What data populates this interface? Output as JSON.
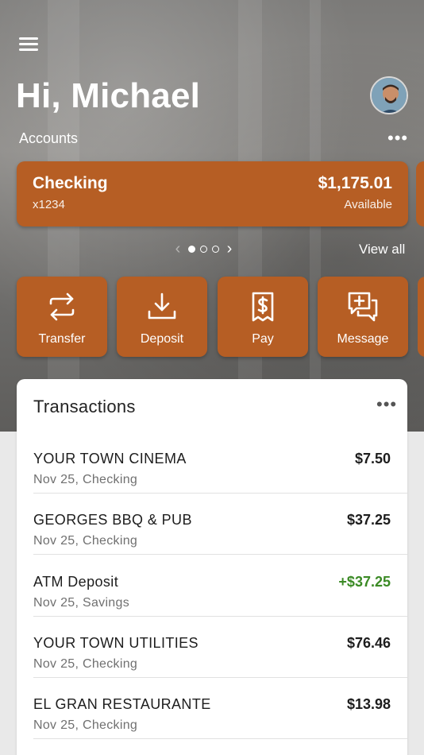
{
  "header": {
    "greeting": "Hi, Michael",
    "accounts_label": "Accounts",
    "menu_icon": "hamburger-menu-icon",
    "more_icon": "ellipsis-icon"
  },
  "account_card": {
    "name": "Checking",
    "number": "x1234",
    "balance": "$1,175.01",
    "balance_label": "Available"
  },
  "pager": {
    "view_all": "View all",
    "pages": 3,
    "current": 1
  },
  "actions": [
    {
      "label": "Transfer",
      "icon": "transfer-arrows-icon"
    },
    {
      "label": "Deposit",
      "icon": "download-tray-icon"
    },
    {
      "label": "Pay",
      "icon": "dollar-receipt-icon"
    },
    {
      "label": "Message",
      "icon": "chat-plus-icon"
    }
  ],
  "transactions": {
    "title": "Transactions",
    "items": [
      {
        "merchant": "YOUR TOWN CINEMA",
        "meta": "Nov 25, Checking",
        "amount": "$7.50",
        "credit": false
      },
      {
        "merchant": "GEORGES BBQ & PUB",
        "meta": "Nov 25, Checking",
        "amount": "$37.25",
        "credit": false
      },
      {
        "merchant": "ATM Deposit",
        "meta": "Nov 25, Savings",
        "amount": "+$37.25",
        "credit": true
      },
      {
        "merchant": "YOUR TOWN UTILITIES",
        "meta": "Nov 25, Checking",
        "amount": "$76.46",
        "credit": false
      },
      {
        "merchant": "EL GRAN RESTAURANTE",
        "meta": "Nov 25, Checking",
        "amount": "$13.98",
        "credit": false
      }
    ]
  },
  "colors": {
    "brand": "#b65e24",
    "credit": "#3b8a25"
  }
}
